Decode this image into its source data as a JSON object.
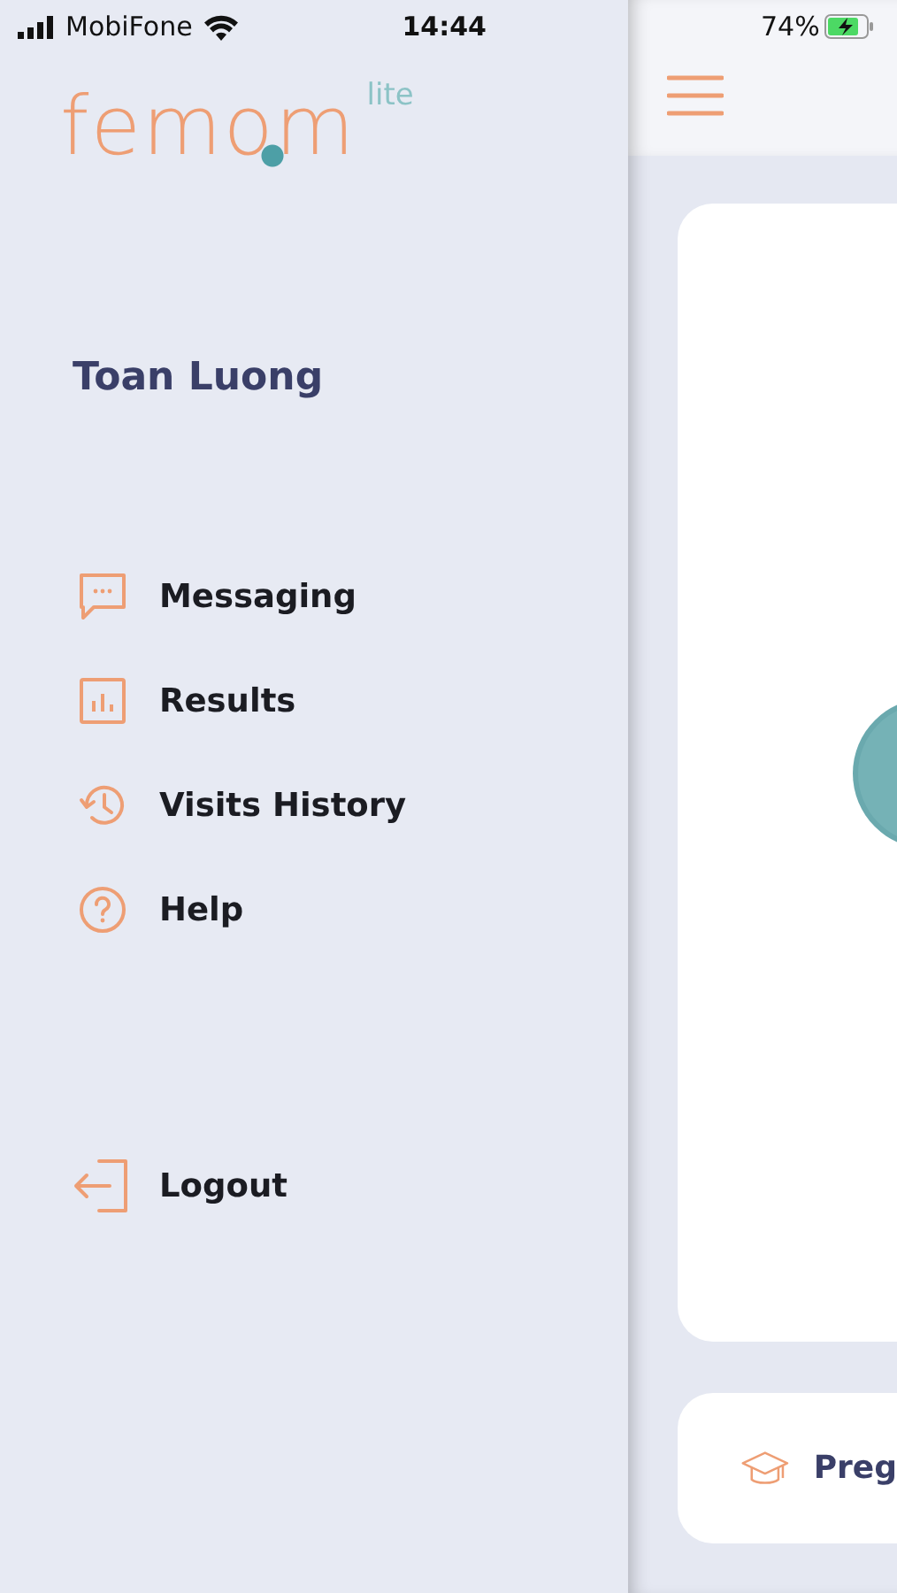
{
  "status_bar": {
    "carrier": "MobiFone",
    "time": "14:44",
    "battery": "74%"
  },
  "logo": {
    "name": "femom",
    "suffix": "lite"
  },
  "user": {
    "name": "Toan Luong"
  },
  "menu": [
    {
      "kind": "chat",
      "label": "Messaging"
    },
    {
      "kind": "chart",
      "label": "Results"
    },
    {
      "kind": "history",
      "label": "Visits History"
    },
    {
      "kind": "help",
      "label": "Help"
    }
  ],
  "logout": {
    "kind": "logout",
    "label": "Logout"
  },
  "main": {
    "lesson_card": {
      "title": "Preg"
    }
  }
}
